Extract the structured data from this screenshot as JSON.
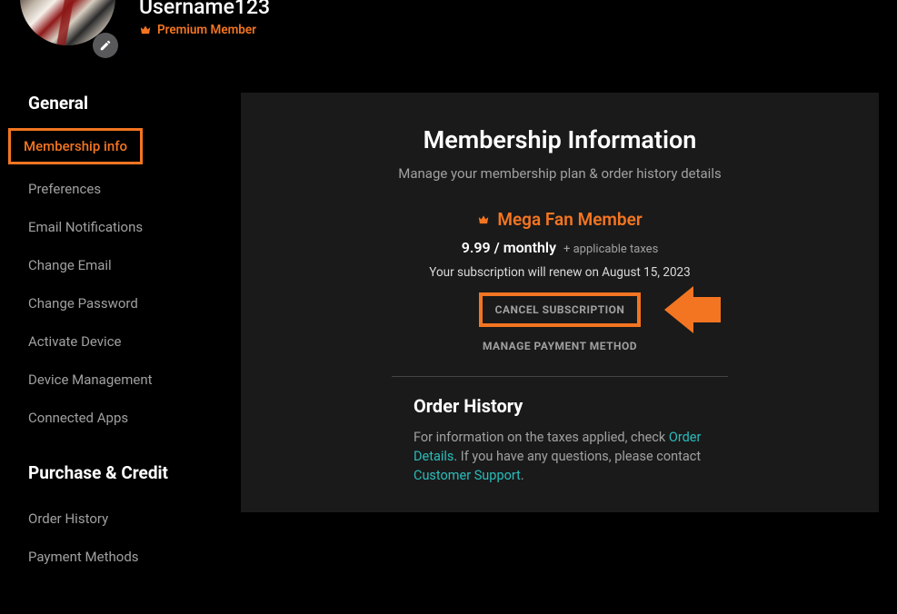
{
  "header": {
    "username": "Username123",
    "premium_label": "Premium Member"
  },
  "sidebar": {
    "section1_title": "General",
    "items1": [
      "Membership info",
      "Preferences",
      "Email Notifications",
      "Change Email",
      "Change Password",
      "Activate Device",
      "Device Management",
      "Connected Apps"
    ],
    "section2_title": "Purchase & Credit",
    "items2": [
      "Order History",
      "Payment Methods"
    ]
  },
  "main": {
    "title": "Membership Information",
    "subtitle": "Manage your membership plan & order history details",
    "tier": "Mega Fan Member",
    "price": "9.99 / monthly",
    "tax_note": "+ applicable taxes",
    "renew_text": "Your subscription will renew on August 15, 2023",
    "cancel_label": "CANCEL SUBSCRIPTION",
    "manage_label": "MANAGE PAYMENT METHOD",
    "order_title": "Order History",
    "order_text_1": "For information on the taxes applied, check ",
    "order_link_1": "Order Details",
    "order_text_2": ". If you have any questions, please contact ",
    "order_link_2": "Customer Support",
    "order_text_3": "."
  }
}
